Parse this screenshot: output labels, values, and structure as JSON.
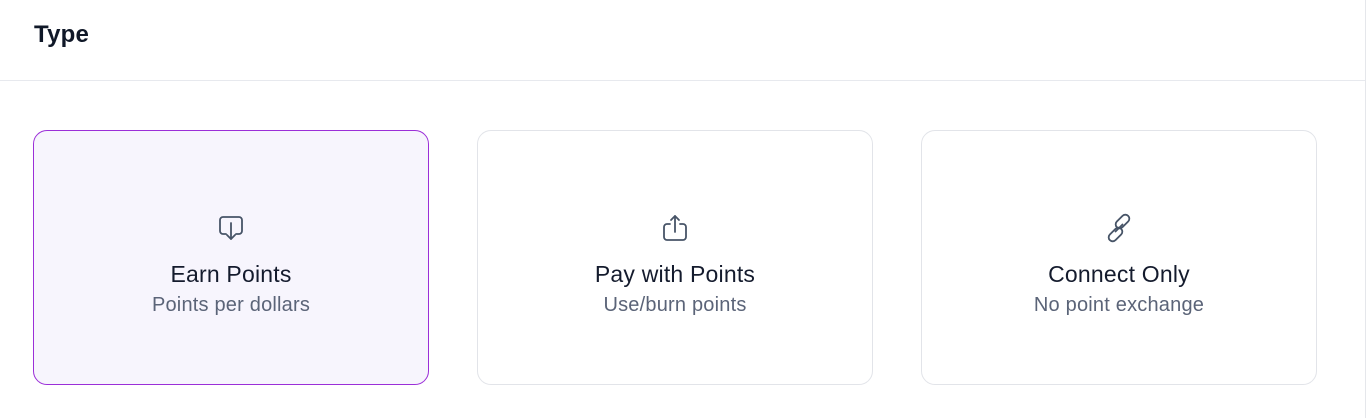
{
  "section": {
    "title": "Type"
  },
  "options": [
    {
      "title": "Earn Points",
      "subtitle": "Points per dollars",
      "icon": "earn-points-icon",
      "selected": true
    },
    {
      "title": "Pay with Points",
      "subtitle": "Use/burn points",
      "icon": "pay-points-icon",
      "selected": false
    },
    {
      "title": "Connect Only",
      "subtitle": "No point exchange",
      "icon": "link-icon",
      "selected": false
    }
  ],
  "colors": {
    "selected_border": "#9b2fd8",
    "selected_background": "#f7f5fd",
    "card_border": "#e2e4e9",
    "icon": "#475467",
    "title_text": "#141b2d",
    "subtitle_text": "#5b6478"
  }
}
